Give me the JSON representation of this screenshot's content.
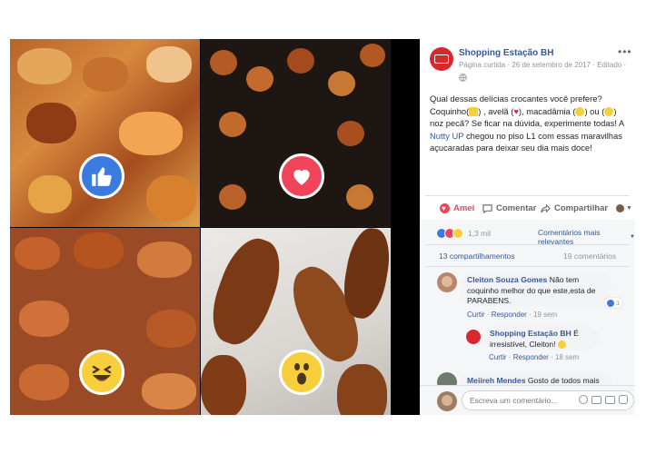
{
  "post": {
    "page_name": "Shopping Estação BH",
    "meta": "Página curtida · 26 de setembro de 2017 · Editado ·",
    "more_icon": "more-horizontal-icon",
    "body": {
      "l1": "Qual dessas delícias crocantes você prefere?",
      "l2a": "Coquinho(",
      "l2b": ") , avelã (",
      "l2c": "), macadâmia (",
      "l2d": ") ou (",
      "l2e": ")",
      "l3": "noz pecã? Se ficar na dúvida, experimente todas! A",
      "l4_link": "Nutty UP",
      "l4_rest": " chegou no piso L1 com essas maravilhas",
      "l5": "açucaradas para deixar seu dia mais doce!"
    },
    "actions": {
      "amei": "Amei",
      "comentar": "Comentar",
      "compartilhar": "Compartilhar"
    },
    "reactions_count": "1,3 mil",
    "sort_label": "Comentários mais relevantes",
    "shares": "13 compartilhamentos",
    "comments_count": "19 comentários"
  },
  "comments": [
    {
      "author": "Cleiton Souza Gomes",
      "text1": " Não tem",
      "text2": "coquinho melhor do que este,esta de",
      "text3": "PARABENS.",
      "like": "Curtir",
      "reply": "Responder",
      "time": "19 sem",
      "reaction_count": "1"
    },
    {
      "author": "Shopping Estação BH",
      "text1": " É",
      "text2": "irresistível, Cleiton!",
      "like": "Curtir",
      "reply": "Responder",
      "time": "18 sem"
    },
    {
      "author": "Meiireh Mendes",
      "text1": " Gosto de todos mais"
    }
  ],
  "composer": {
    "placeholder": "Escreva um comentário..."
  },
  "icons": {
    "like": "like-thumbs-up-icon",
    "love": "love-heart-icon",
    "haha": "haha-laugh-icon",
    "wow": "wow-surprised-icon"
  },
  "colors": {
    "brand_red": "#d9272e",
    "fb_link": "#365899",
    "like_blue": "#3b7be0",
    "love_red": "#f0445b",
    "emoji_yellow": "#f7cf3c"
  }
}
